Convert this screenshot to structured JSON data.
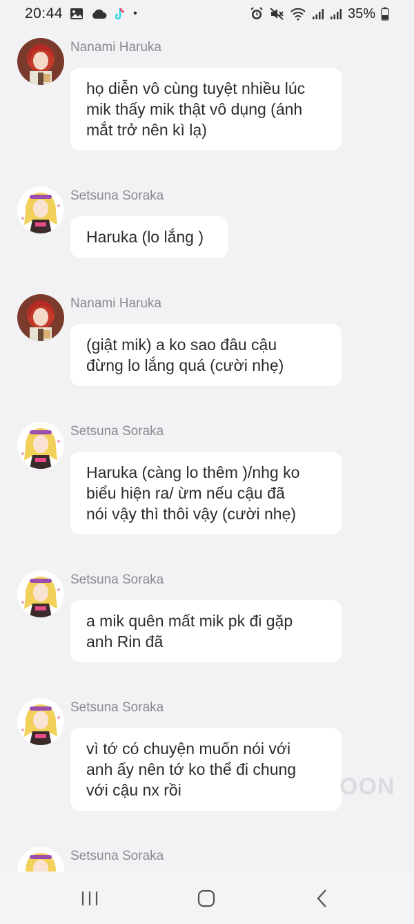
{
  "status_bar": {
    "time": "20:44",
    "battery": "35%",
    "dot": "•",
    "icons": [
      "gallery-icon",
      "cloud-icon",
      "tiktok-icon",
      "alarm-icon",
      "mute-icon",
      "wifi-icon",
      "signal-icon",
      "signal-icon-2",
      "battery-icon"
    ]
  },
  "messages": [
    {
      "sender": "Nanami Haruka",
      "avatar": "avatar-red-hair",
      "text": "họ diễn vô cùng tuyệt nhiều lúc\nmik thấy mik thật vô dụng (ánh\nmắt trở nên kì lạ)"
    },
    {
      "sender": "Setsuna Soraka",
      "avatar": "avatar-blonde-hair",
      "text": "Haruka (lo lắng )"
    },
    {
      "sender": "Nanami Haruka",
      "avatar": "avatar-red-hair",
      "text": "(giật mik) a ko sao đâu cậu\nđừng lo lắng quá (cười nhẹ)"
    },
    {
      "sender": "Setsuna Soraka",
      "avatar": "avatar-blonde-hair",
      "text": "Haruka (càng lo thêm )/nhg ko\nbiểu hiện ra/ ừm nếu cậu đã\nnói vậy thì thôi vậy (cười nhẹ)"
    },
    {
      "sender": "Setsuna Soraka",
      "avatar": "avatar-blonde-hair",
      "text": "a mik quên mất mik pk đi gặp\nanh Rin đã"
    },
    {
      "sender": "Setsuna Soraka",
      "avatar": "avatar-blonde-hair",
      "text": "vì tớ có chuyện muốn nói với\nanh ấy nên tớ ko thể đi chung\nvới cậu nx rồi"
    },
    {
      "sender": "Setsuna Soraka",
      "avatar": "avatar-blonde-hair",
      "text": ""
    }
  ],
  "watermark": "OON",
  "nav_bar": {
    "buttons": [
      "recent-apps-icon",
      "home-icon",
      "back-icon"
    ]
  },
  "colors": {
    "background": "#f2f2f4",
    "bubble": "#ffffff",
    "name_text": "#8a8a90",
    "message_text": "#2b2b2b"
  }
}
